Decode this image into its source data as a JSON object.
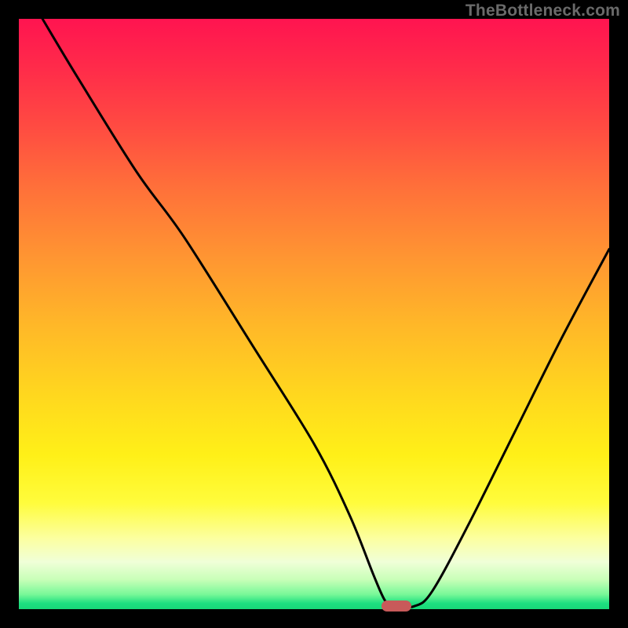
{
  "watermark": "TheBottleneck.com",
  "chart_data": {
    "type": "line",
    "title": "",
    "xlabel": "",
    "ylabel": "",
    "xlim": [
      0,
      100
    ],
    "ylim": [
      0,
      100
    ],
    "grid": false,
    "legend": false,
    "series": [
      {
        "name": "bottleneck-curve",
        "x": [
          4,
          10,
          20,
          28,
          40,
          50,
          56,
          60,
          62,
          63.5,
          67,
          70,
          76,
          84,
          92,
          100
        ],
        "y": [
          100,
          90,
          74,
          63,
          44,
          28,
          16,
          6,
          1.5,
          0.5,
          0.5,
          3,
          14,
          30,
          46,
          61
        ]
      }
    ],
    "marker": {
      "name": "optimal-point",
      "x": 64,
      "y": 0.5,
      "color": "#c85a5a"
    },
    "gradient_stops": [
      {
        "pos": 0,
        "color": "#ff1450"
      },
      {
        "pos": 50,
        "color": "#ffb828"
      },
      {
        "pos": 80,
        "color": "#fffc3c"
      },
      {
        "pos": 100,
        "color": "#18d878"
      }
    ]
  }
}
